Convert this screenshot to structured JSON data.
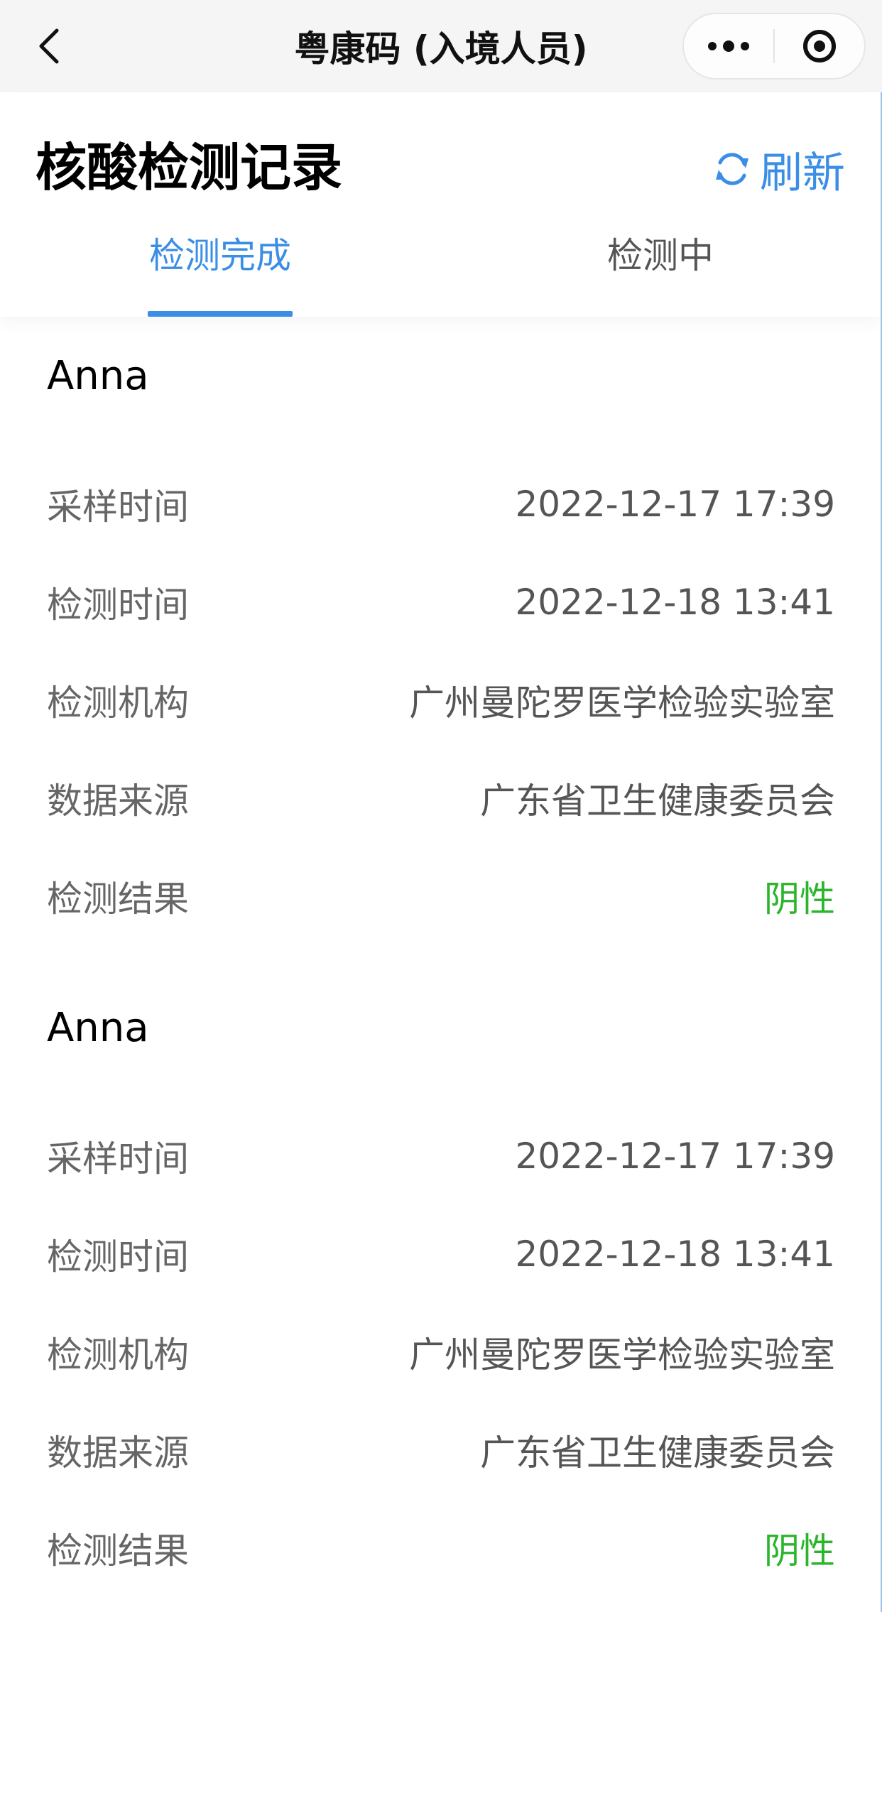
{
  "navbar": {
    "title": "粤康码 (入境人员)",
    "back_icon": "chevron-left-icon",
    "more_icon": "more-dots-icon",
    "close_icon": "target-circle-icon"
  },
  "header": {
    "title": "核酸检测记录",
    "refresh_label": "刷新",
    "refresh_icon": "refresh-icon"
  },
  "tabs": [
    {
      "label": "检测完成",
      "active": true
    },
    {
      "label": "检测中",
      "active": false
    }
  ],
  "records": [
    {
      "name": "Anna",
      "fields": [
        {
          "label": "采样时间",
          "value": "2022-12-17 17:39"
        },
        {
          "label": "检测时间",
          "value": "2022-12-18 13:41"
        },
        {
          "label": "检测机构",
          "value": "广州曼陀罗医学检验实验室"
        },
        {
          "label": "数据来源",
          "value": "广东省卫生健康委员会"
        },
        {
          "label": "检测结果",
          "value": "阴性"
        }
      ]
    },
    {
      "name": "Anna",
      "fields": [
        {
          "label": "采样时间",
          "value": "2022-12-17 17:39"
        },
        {
          "label": "检测时间",
          "value": "2022-12-18 13:41"
        },
        {
          "label": "检测机构",
          "value": "广州曼陀罗医学检验实验室"
        },
        {
          "label": "数据来源",
          "value": "广东省卫生健康委员会"
        },
        {
          "label": "检测结果",
          "value": "阴性"
        }
      ]
    }
  ],
  "colors": {
    "accent": "#3a8ee6",
    "negative_result": "#2cb52c",
    "label_text": "#666666",
    "navbar_bg": "#f5f5f5"
  }
}
